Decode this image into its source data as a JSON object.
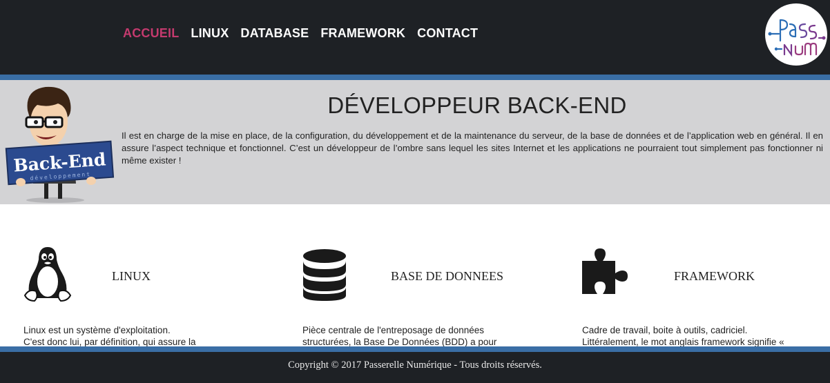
{
  "nav": {
    "items": [
      {
        "label": "ACCUEIL",
        "active": true
      },
      {
        "label": "LINUX",
        "active": false
      },
      {
        "label": "DATABASE",
        "active": false
      },
      {
        "label": "FRAMEWORK",
        "active": false
      },
      {
        "label": "CONTACT",
        "active": false
      }
    ],
    "active_color": "#c43a6e"
  },
  "logo": {
    "text": "Passerelle Numérique",
    "icon": "passerelle-numerique-logo"
  },
  "hero": {
    "title": "DÉVELOPPEUR BACK-END",
    "text": "Il est en charge de la mise en place, de la configuration, du développement et de la maintenance du serveur, de la base de données et de l’application web en général. Il en assure l’aspect technique et fonctionnel. C’est un développeur de l’ombre sans lequel les sites Internet et les applications ne pourraient tout simplement pas fonctionner ni même exister !",
    "mascot_sign": "Back-End",
    "mascot_sign_sub": "développement"
  },
  "features": [
    {
      "icon": "linux-tux-icon",
      "title": "LINUX",
      "lines": [
        "Linux est un système d'exploitation.",
        "C'est donc lui, par définition, qui assure la"
      ]
    },
    {
      "icon": "database-icon",
      "title": "BASE DE DONNEES",
      "lines": [
        "Pièce centrale de l'entreposage de données",
        "structurées, la Base De Données (BDD) a pour"
      ]
    },
    {
      "icon": "puzzle-piece-icon",
      "title": "FRAMEWORK",
      "lines": [
        "Cadre de travail, boite à outils, cadriciel.",
        "Littéralement, le mot anglais framework signifie «"
      ]
    }
  ],
  "footer": {
    "copyright": "Copyright © 2017 Passerelle Numérique - Tous droits réservés."
  },
  "colors": {
    "header_bg": "#1e2125",
    "stripe": "#3a6ea5",
    "hero_bg": "#d3d3d5",
    "accent": "#c43a6e",
    "logo_blue": "#2a6db5",
    "logo_purple": "#7a3a8e"
  }
}
